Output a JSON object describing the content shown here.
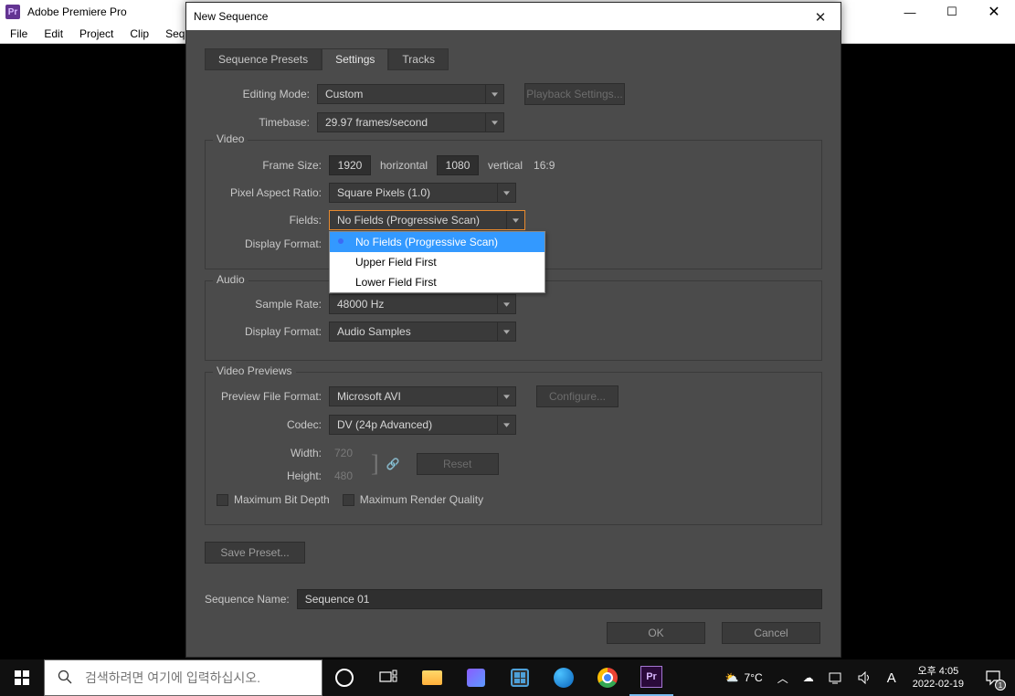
{
  "app": {
    "title": "Adobe Premiere Pro"
  },
  "menubar": [
    "File",
    "Edit",
    "Project",
    "Clip",
    "Sequer"
  ],
  "window_controls": {
    "minimize": "—",
    "maximize": "☐",
    "close": "✕"
  },
  "dialog": {
    "title": "New Sequence",
    "tabs": [
      "Sequence Presets",
      "Settings",
      "Tracks"
    ],
    "active_tab": 1,
    "labels": {
      "editing_mode": "Editing Mode:",
      "timebase": "Timebase:",
      "frame_size": "Frame Size:",
      "horizontal": "horizontal",
      "vertical": "vertical",
      "aspect": "16:9",
      "pixel_aspect": "Pixel Aspect Ratio:",
      "fields": "Fields:",
      "display_format": "Display Format:",
      "sample_rate": "Sample Rate:",
      "audio_display_format": "Display Format:",
      "preview_file_format": "Preview File Format:",
      "codec": "Codec:",
      "width": "Width:",
      "height": "Height:",
      "max_bit_depth": "Maximum Bit Depth",
      "max_render_quality": "Maximum Render Quality",
      "sequence_name": "Sequence Name:"
    },
    "group_titles": {
      "video": "Video",
      "audio": "Audio",
      "video_previews": "Video Previews"
    },
    "values": {
      "editing_mode": "Custom",
      "timebase": "29.97 frames/second",
      "frame_w": "1920",
      "frame_h": "1080",
      "pixel_aspect": "Square Pixels (1.0)",
      "fields": "No Fields (Progressive Scan)",
      "sample_rate": "48000 Hz",
      "audio_display_format": "Audio Samples",
      "preview_file_format": "Microsoft AVI",
      "codec": "DV (24p Advanced)",
      "width": "720",
      "height": "480",
      "sequence_name": "Sequence 01"
    },
    "buttons": {
      "playback_settings": "Playback Settings...",
      "configure": "Configure...",
      "reset": "Reset",
      "save_preset": "Save Preset...",
      "ok": "OK",
      "cancel": "Cancel"
    },
    "fields_dropdown": {
      "options": [
        "No Fields (Progressive Scan)",
        "Upper Field First",
        "Lower Field First"
      ],
      "selected_index": 0
    },
    "link_icon": "🔗"
  },
  "taskbar": {
    "search_placeholder": "검색하려면 여기에 입력하십시오.",
    "weather": "7°C",
    "ime": "A",
    "time": "오후 4:05",
    "date": "2022-02-19",
    "notif_count": "1"
  }
}
